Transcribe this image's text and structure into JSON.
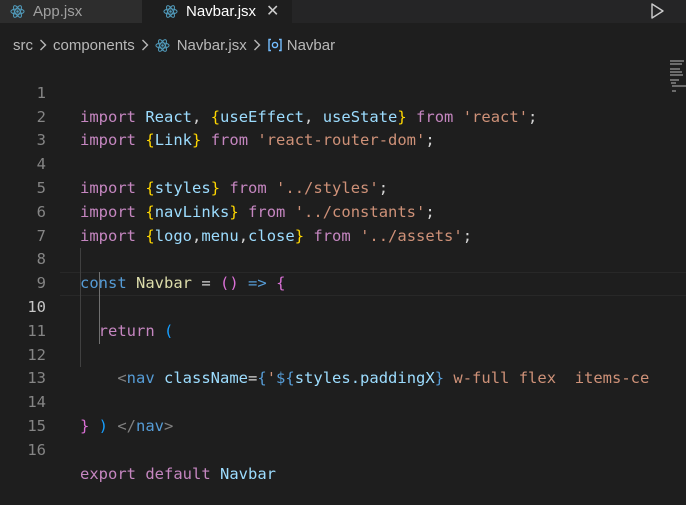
{
  "tabs": [
    {
      "label": "App.jsx",
      "active": false
    },
    {
      "label": "Navbar.jsx",
      "active": true
    }
  ],
  "tab_close_glyph": "✕",
  "breadcrumb": {
    "folder1": "src",
    "folder2": "components",
    "file": "Navbar.jsx",
    "symbol": "Navbar"
  },
  "colors": {
    "background": "#1e1e1e",
    "keyword_import": "#c586c0",
    "keyword": "#569cd6",
    "variable": "#9cdcfe",
    "string": "#ce9178",
    "brace_level1": "#ffd700",
    "brace_level2": "#da70d6",
    "brace_level3": "#179fff",
    "line_number": "#858585"
  },
  "icons": {
    "tab_file": "react-icon",
    "run": "play-icon",
    "breadcrumb_sep": "chevron-right-icon",
    "symbol": "symbol-brackets-icon"
  },
  "current_line": 10,
  "code": {
    "l1": {
      "import": "import",
      "react": "React",
      "comma": ", ",
      "ob": "{",
      "ue": "useEffect",
      "c2": ", ",
      "us": "useState",
      "cb": "}",
      "from": "from",
      "str": "'react'",
      "semi": ";"
    },
    "l2": {
      "import": "import",
      "ob": "{",
      "link": "Link",
      "cb": "}",
      "from": "from",
      "str": "'react-router-dom'",
      "semi": ";"
    },
    "l4": {
      "import": "import",
      "ob": "{",
      "styles": "styles",
      "cb": "}",
      "from": "from",
      "str": "'../styles'",
      "semi": ";"
    },
    "l5": {
      "import": "import",
      "ob": "{",
      "navLinks": "navLinks",
      "cb": "}",
      "from": "from",
      "str": "'../constants'",
      "semi": ";"
    },
    "l6": {
      "import": "import",
      "ob": "{",
      "logo": "logo",
      "c1": ",",
      "menu": "menu",
      "c2": ",",
      "close": "close",
      "cb": "}",
      "from": "from",
      "str": "'../assets'",
      "semi": ";"
    },
    "l8": {
      "const": "const",
      "name": "Navbar",
      "eq": " = ",
      "op": "(",
      "cp": ")",
      "arrow": "=>",
      "ob": "{"
    },
    "l9": {
      "ret": "return",
      "op": "("
    },
    "l10": {
      "lt": "<",
      "tag": "nav",
      "attr": "className",
      "eq": "=",
      "ob": "{",
      "tick": "'",
      "dl": "${",
      "expr": "styles.paddingX",
      "dc": "}",
      "rest": " w-full flex  items-ce"
    },
    "l12": {
      "lt": "</",
      "tag": "nav",
      "gt": ">"
    },
    "l13": {
      "cp": ")"
    },
    "l14": {
      "cb": "}"
    },
    "l16": {
      "export": "export",
      "default": "default",
      "name": "Navbar"
    }
  },
  "line_numbers": [
    "1",
    "2",
    "3",
    "4",
    "5",
    "6",
    "7",
    "8",
    "9",
    "10",
    "11",
    "12",
    "13",
    "14",
    "15",
    "16"
  ]
}
